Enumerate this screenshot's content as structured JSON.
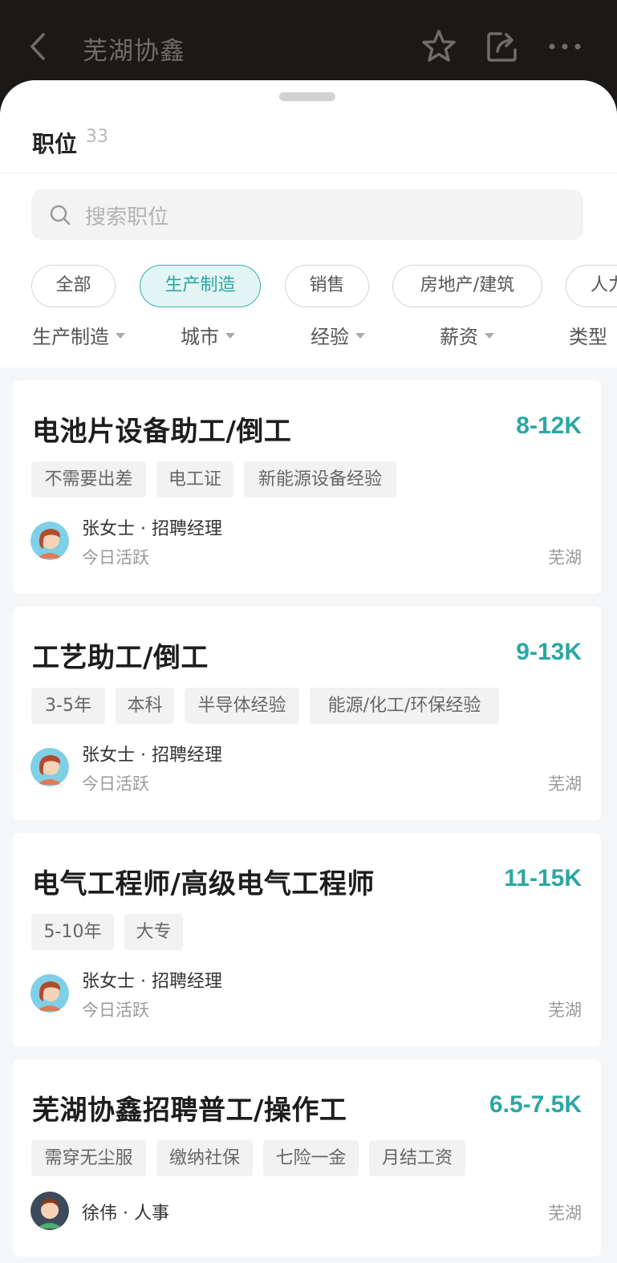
{
  "header": {
    "title": "芜湖协鑫"
  },
  "section": {
    "title": "职位",
    "count": "33"
  },
  "search": {
    "placeholder": "搜索职位"
  },
  "categories": [
    "全部",
    "生产制造",
    "销售",
    "房地产/建筑",
    "人力"
  ],
  "active_category": "生产制造",
  "filters": [
    "生产制造",
    "城市",
    "经验",
    "薪资",
    "类型"
  ],
  "colors": {
    "accent": "#2aa7a4",
    "topbar": "#1b1818"
  },
  "jobs": [
    {
      "title": "电池片设备助工/倒工",
      "salary": "8-12K",
      "tags": [
        "不需要出差",
        "电工证",
        "新能源设备经验"
      ],
      "recruiter": "张女士 · 招聘经理",
      "status": "今日活跃",
      "city": "芜湖"
    },
    {
      "title": "工艺助工/倒工",
      "salary": "9-13K",
      "tags": [
        "3-5年",
        "本科",
        "半导体经验",
        "能源/化工/环保经验"
      ],
      "recruiter": "张女士 · 招聘经理",
      "status": "今日活跃",
      "city": "芜湖"
    },
    {
      "title": "电气工程师/高级电气工程师",
      "salary": "11-15K",
      "tags": [
        "5-10年",
        "大专"
      ],
      "recruiter": "张女士 · 招聘经理",
      "status": "今日活跃",
      "city": "芜湖"
    },
    {
      "title": "芜湖协鑫招聘普工/操作工",
      "salary": "6.5-7.5K",
      "tags": [
        "需穿无尘服",
        "缴纳社保",
        "七险一金",
        "月结工资"
      ],
      "recruiter": "徐伟 · 人事",
      "city": "芜湖"
    }
  ]
}
